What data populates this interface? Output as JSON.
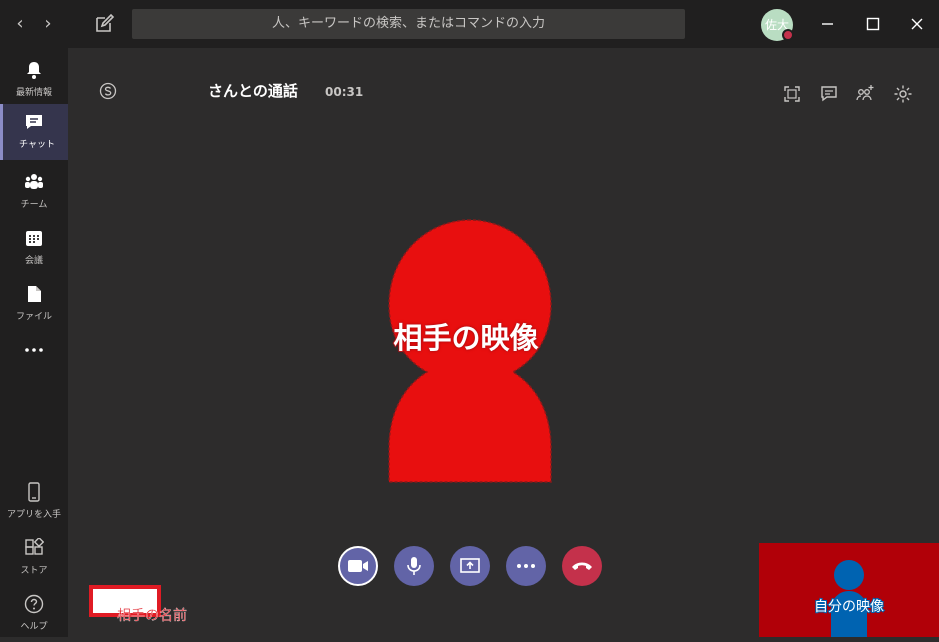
{
  "search": {
    "placeholder": "人、キーワードの検索、またはコマンドの入力"
  },
  "user": {
    "initials": "佐大"
  },
  "rail": {
    "items": [
      {
        "label": "最新情報",
        "icon": "bell-icon"
      },
      {
        "label": "チャット",
        "icon": "chat-icon",
        "active": true
      },
      {
        "label": "チーム",
        "icon": "teams-icon"
      },
      {
        "label": "会議",
        "icon": "calendar-icon"
      },
      {
        "label": "ファイル",
        "icon": "file-icon"
      },
      {
        "label": "",
        "icon": "more-icon"
      }
    ],
    "bottom": [
      {
        "label": "アプリを入手",
        "icon": "phone-icon"
      },
      {
        "label": "ストア",
        "icon": "store-icon"
      },
      {
        "label": "ヘルプ",
        "icon": "help-icon"
      }
    ]
  },
  "call": {
    "title": "さんとの通話",
    "timer": "00:31",
    "remote_label": "相手の映像",
    "name_label": "相手の名前",
    "self_label": "自分の映像"
  },
  "colors": {
    "accent": "#6264a7",
    "hangup": "#c4314b",
    "annotation": "#e01b24"
  }
}
